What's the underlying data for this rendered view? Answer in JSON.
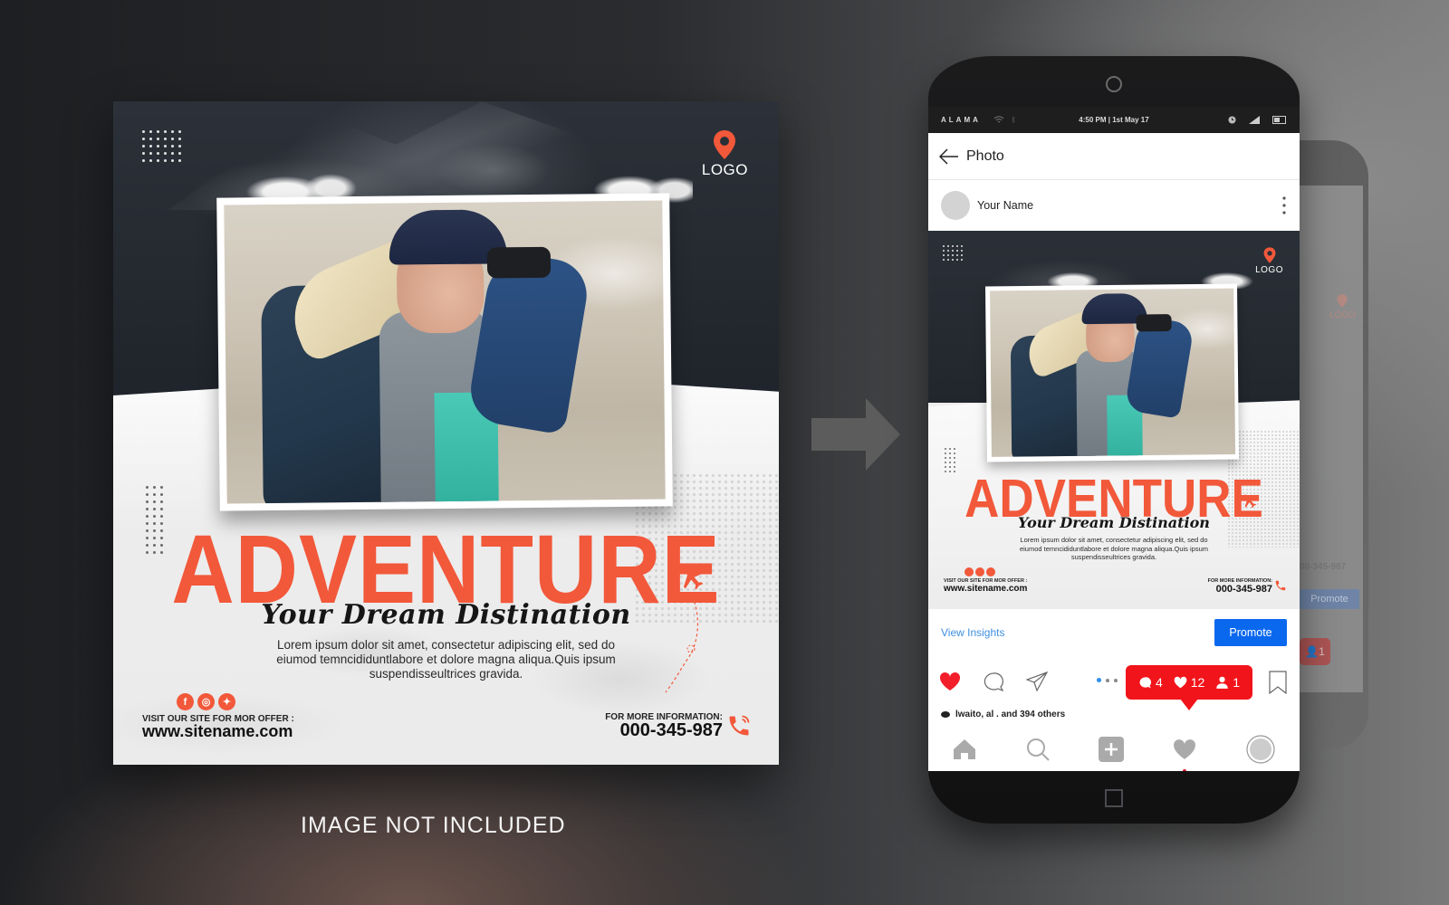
{
  "post": {
    "logo_text": "LOGO",
    "headline": "ADVENTURE",
    "tagline": "Your Dream Distination",
    "body": "Lorem ipsum dolor sit amet, consectetur adipiscing elit, sed do eiumod temncididuntlabore et dolore magna aliqua.Quis ipsum suspendisseultrices gravida.",
    "social": [
      {
        "icon": "facebook-icon",
        "glyph": "f"
      },
      {
        "icon": "instagram-icon",
        "glyph": "◎"
      },
      {
        "icon": "twitter-icon",
        "glyph": "✦"
      }
    ],
    "visit_label": "VISIT OUR SITE FOR MOR OFFER :",
    "site_url": "www.sitename.com",
    "info_label": "FOR MORE INFORMATION:",
    "phone": "000-345-987"
  },
  "caption": "IMAGE NOT INCLUDED",
  "colors": {
    "accent": "#f2583a",
    "promote_blue": "#0a68ef",
    "link_blue": "#3f8fe0",
    "notification_red": "#f2141b",
    "like_red": "#f21f2a"
  },
  "phone": {
    "status": {
      "carrier": "ALAMA",
      "time": "4:50 PM | 1st May 17"
    },
    "topbar": {
      "back_icon": "arrow-left-icon",
      "title": "Photo"
    },
    "profile": {
      "name": "Your Name"
    },
    "insights_link": "View Insights",
    "promote_button": "Promote",
    "carousel": {
      "count": 3,
      "active": 0
    },
    "activity": {
      "comments": "4",
      "likes": "12",
      "followers": "1"
    },
    "likes_text": "lwaito, al . and 394 others",
    "tabs": [
      {
        "name": "home",
        "icon": "home-icon"
      },
      {
        "name": "search",
        "icon": "search-icon"
      },
      {
        "name": "add",
        "icon": "plus-square-icon"
      },
      {
        "name": "activity",
        "icon": "heart-icon"
      },
      {
        "name": "profile",
        "icon": "profile-circle-icon"
      }
    ]
  },
  "back_phone": {
    "logo_text": "LOGO",
    "phone": "00-345-987",
    "promote_button": "Promote",
    "followers": "1"
  }
}
